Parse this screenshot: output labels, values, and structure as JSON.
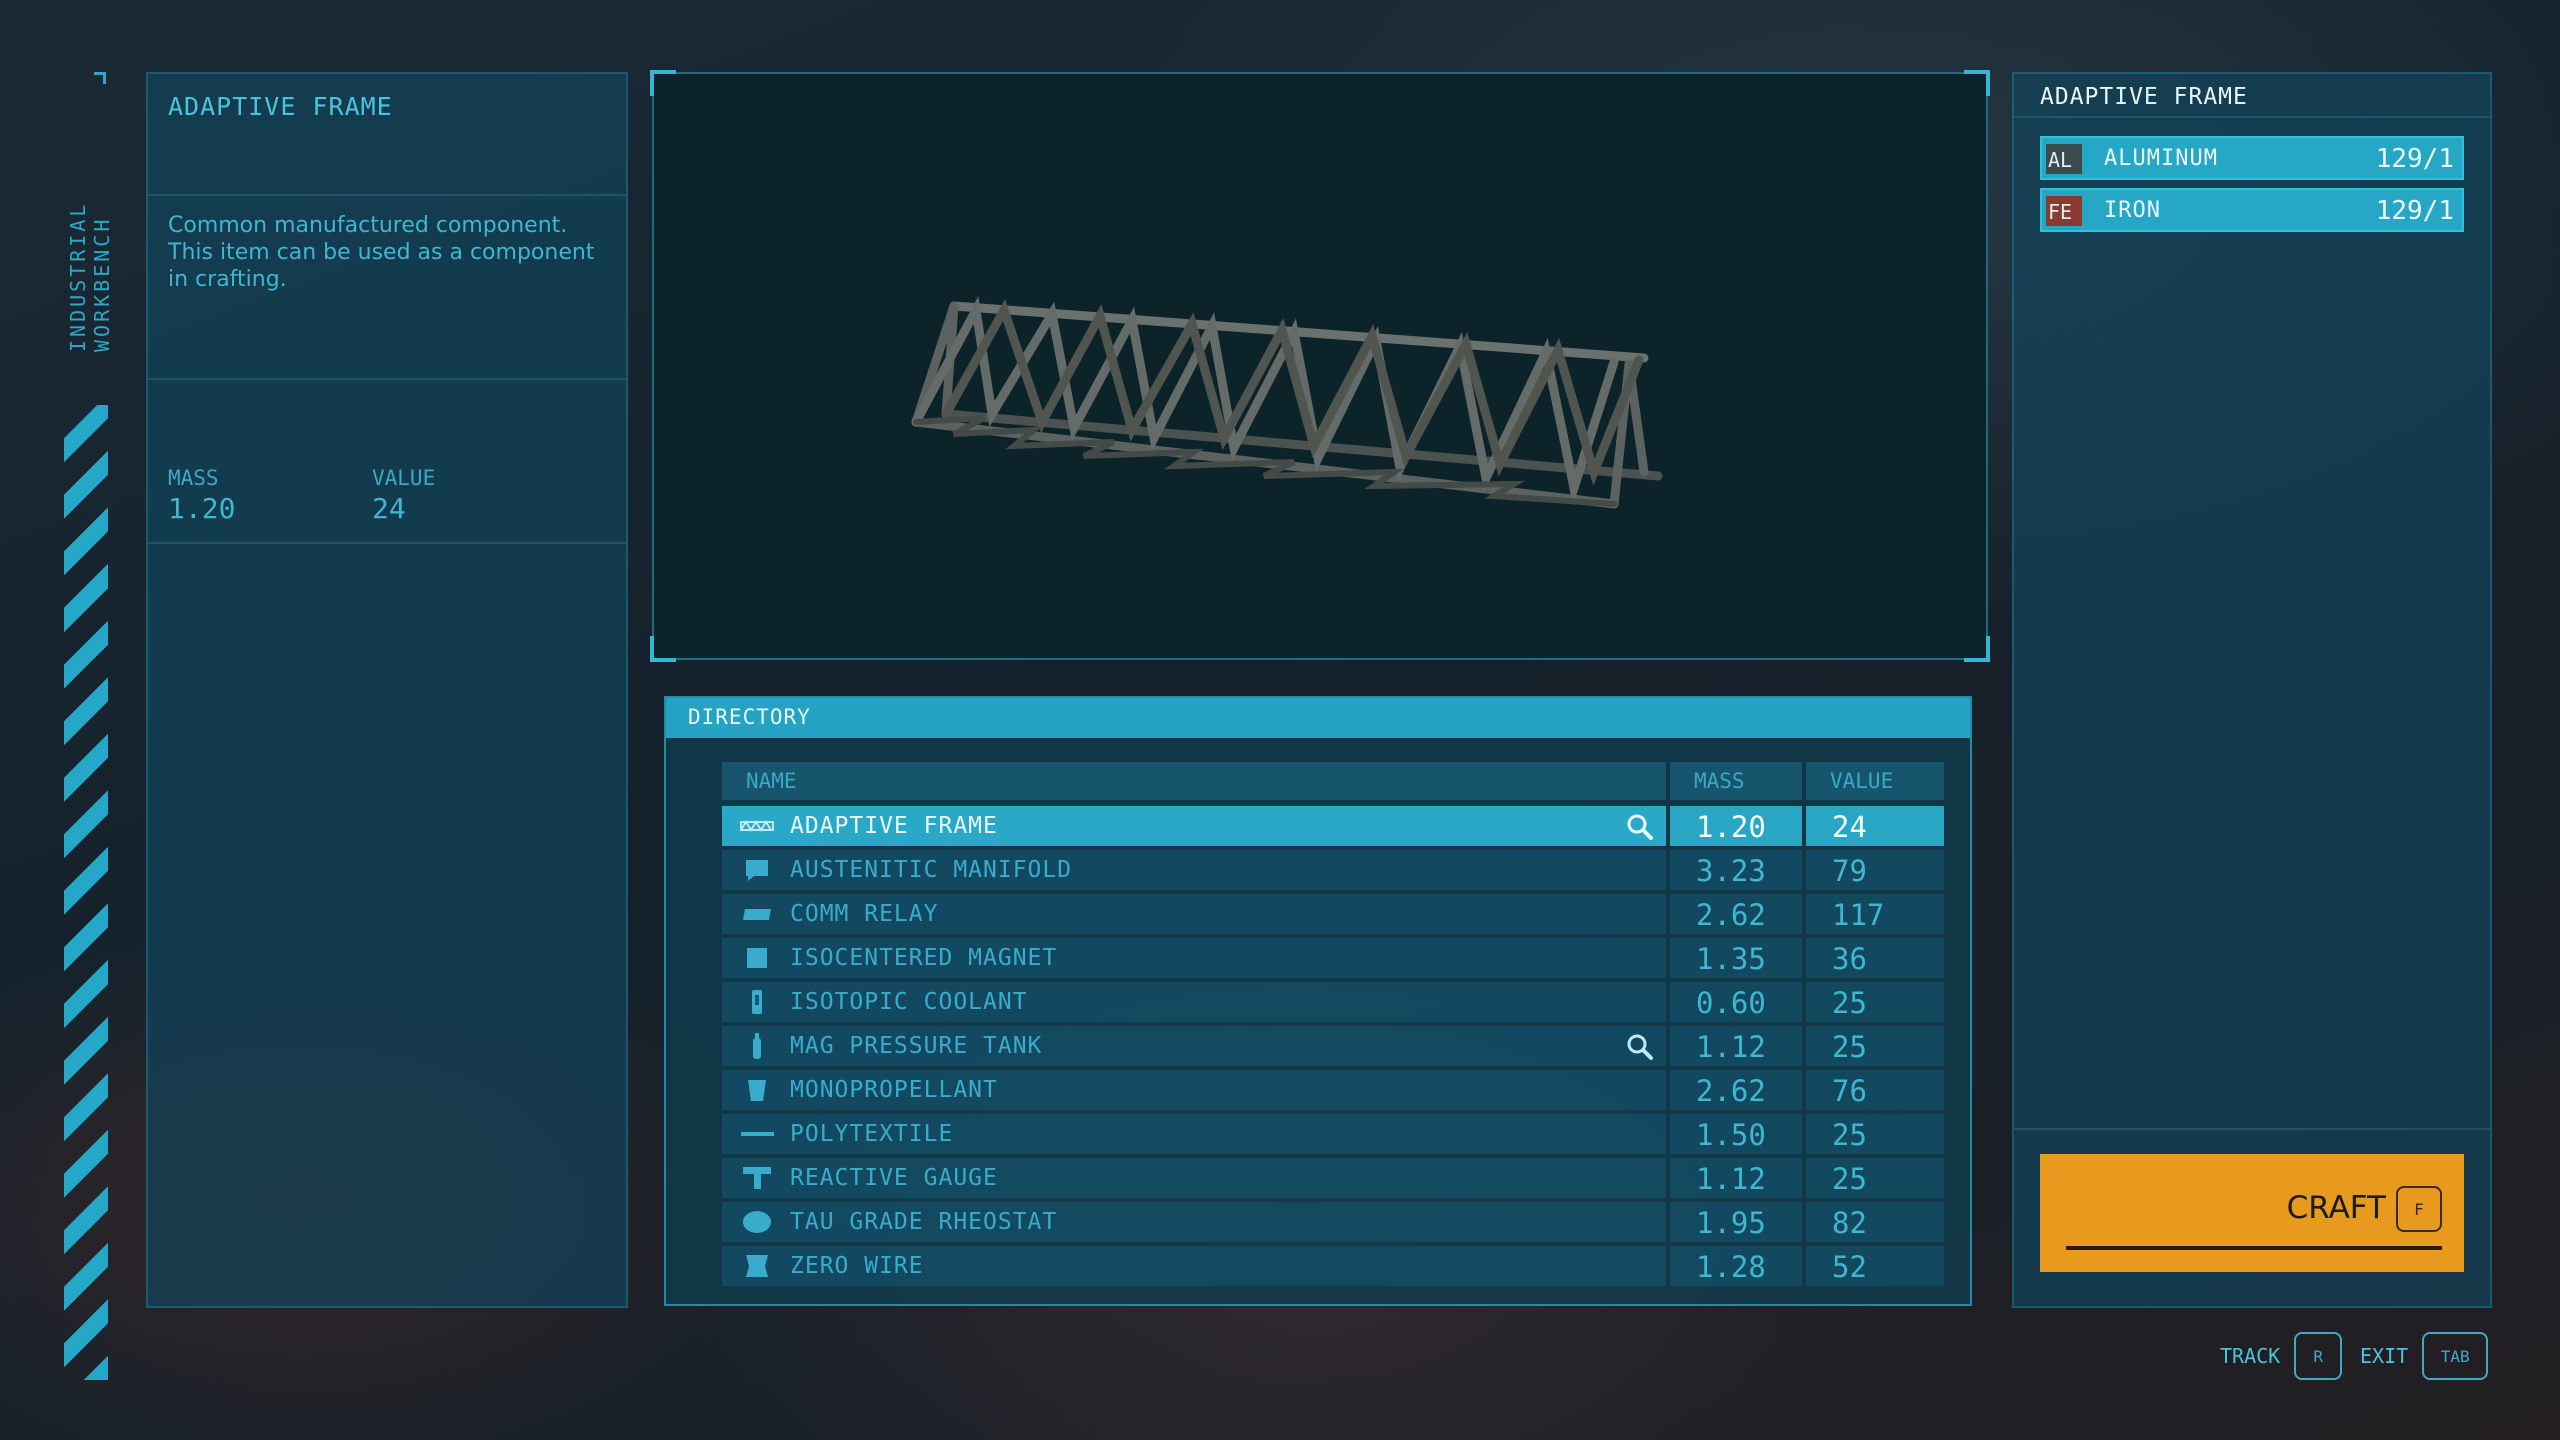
{
  "sidebar": {
    "vertical_label": "INDUSTRIAL WORKBENCH"
  },
  "info": {
    "title": "ADAPTIVE FRAME",
    "description": "Common manufactured component. This item can be used as a component in crafting.",
    "mass_label": "MASS",
    "mass_value": "1.20",
    "value_label": "VALUE",
    "value_value": "24"
  },
  "directory": {
    "header": "DIRECTORY",
    "columns": {
      "name": "NAME",
      "mass": "MASS",
      "value": "VALUE"
    },
    "rows": [
      {
        "name": "ADAPTIVE FRAME",
        "mass": "1.20",
        "value": "24",
        "icon": "frame-icon",
        "selected": true,
        "tracked": true
      },
      {
        "name": "AUSTENITIC MANIFOLD",
        "mass": "3.23",
        "value": "79",
        "icon": "manifold-icon"
      },
      {
        "name": "COMM RELAY",
        "mass": "2.62",
        "value": "117",
        "icon": "relay-icon"
      },
      {
        "name": "ISOCENTERED MAGNET",
        "mass": "1.35",
        "value": "36",
        "icon": "magnet-icon"
      },
      {
        "name": "ISOTOPIC COOLANT",
        "mass": "0.60",
        "value": "25",
        "icon": "coolant-icon"
      },
      {
        "name": "MAG PRESSURE TANK",
        "mass": "1.12",
        "value": "25",
        "icon": "tank-icon",
        "tracked": true
      },
      {
        "name": "MONOPROPELLANT",
        "mass": "2.62",
        "value": "76",
        "icon": "propellant-icon"
      },
      {
        "name": "POLYTEXTILE",
        "mass": "1.50",
        "value": "25",
        "icon": "textile-icon"
      },
      {
        "name": "REACTIVE GAUGE",
        "mass": "1.12",
        "value": "25",
        "icon": "gauge-icon"
      },
      {
        "name": "TAU GRADE RHEOSTAT",
        "mass": "1.95",
        "value": "82",
        "icon": "rheostat-icon"
      },
      {
        "name": "ZERO WIRE",
        "mass": "1.28",
        "value": "52",
        "icon": "wire-icon"
      }
    ]
  },
  "recipe": {
    "title": "ADAPTIVE FRAME",
    "resources": [
      {
        "symbol": "AL",
        "name": "ALUMINUM",
        "qty": "129/1",
        "color": "#3b4a4d"
      },
      {
        "symbol": "FE",
        "name": "IRON",
        "qty": "129/1",
        "color": "#8a3a30"
      }
    ],
    "craft_label": "CRAFT",
    "craft_key": "F"
  },
  "footer": {
    "track_label": "TRACK",
    "track_key": "R",
    "exit_label": "EXIT",
    "exit_key": "TAB"
  },
  "colors": {
    "accent": "#28a6c4",
    "craft": "#e89a1f"
  }
}
